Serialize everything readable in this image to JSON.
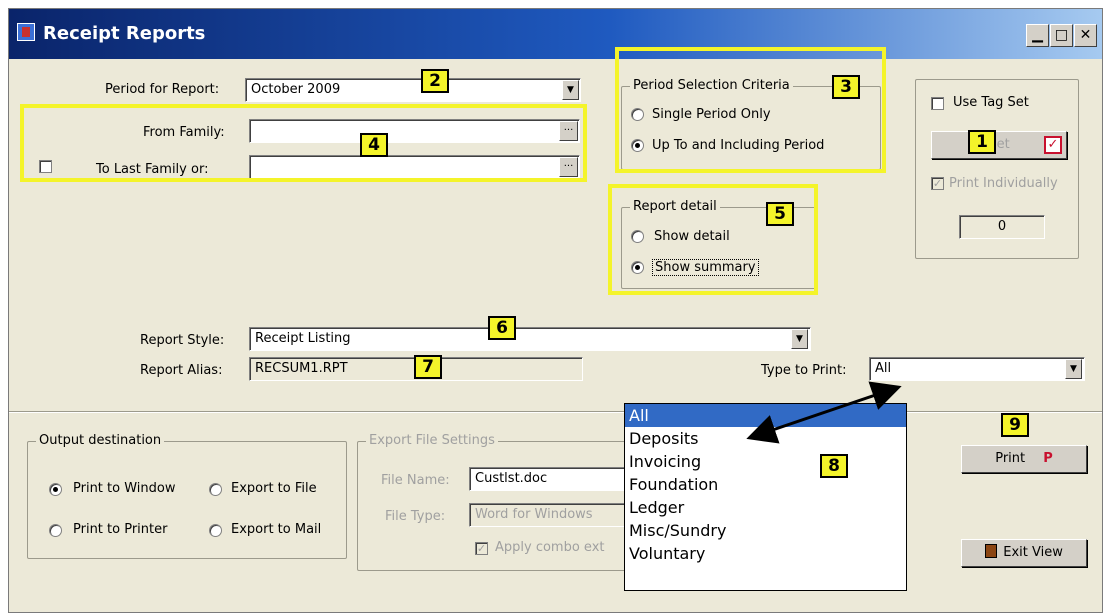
{
  "window": {
    "title": "Receipt Reports"
  },
  "period": {
    "label": "Period for Report:",
    "value": "October 2009"
  },
  "family": {
    "from_label": "From Family:",
    "to_label": "To Last Family or:",
    "ellipsis": "..."
  },
  "period_criteria": {
    "legend": "Period Selection Criteria",
    "options": [
      "Single Period Only",
      "Up To and Including Period"
    ],
    "selected": 1
  },
  "report_detail": {
    "legend": "Report detail",
    "options": [
      "Show detail",
      "Show summary"
    ],
    "selected": 1
  },
  "tag_set": {
    "use_label": "Use Tag Set",
    "set_button": "Set",
    "print_individually": "Print Individually",
    "count": "0"
  },
  "report_style": {
    "label": "Report Style:",
    "value": "Receipt Listing"
  },
  "report_alias": {
    "label": "Report Alias:",
    "value": "RECSUM1.RPT"
  },
  "type_to_print": {
    "label": "Type to Print:",
    "value": "All",
    "options": [
      "All",
      "Deposits",
      "Invoicing",
      "Foundation",
      "Ledger",
      "Misc/Sundry",
      "Voluntary"
    ],
    "selected": 0
  },
  "output": {
    "legend": "Output destination",
    "options": [
      "Print to Window",
      "Export to File",
      "Print to Printer",
      "Export to Mail"
    ],
    "selected": 0
  },
  "export_settings": {
    "legend": "Export File Settings",
    "file_name_label": "File Name:",
    "file_name": "Custlst.doc",
    "file_type_label": "File Type:",
    "file_type": "Word for Windows",
    "apply_label": "Apply combo ext"
  },
  "buttons": {
    "print": "Print",
    "print_hotkey": "P",
    "exit": "Exit View"
  },
  "callouts": [
    "1",
    "2",
    "3",
    "4",
    "5",
    "6",
    "7",
    "8",
    "9"
  ],
  "colors": {
    "highlight": "#f4f42a",
    "selection": "#316ac5"
  }
}
